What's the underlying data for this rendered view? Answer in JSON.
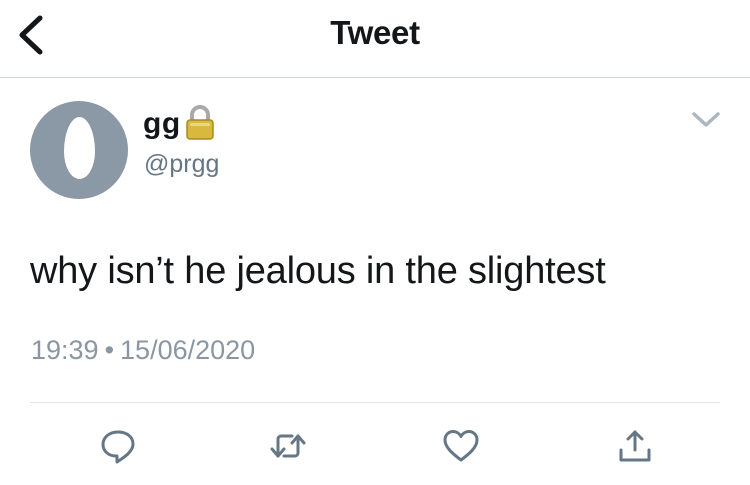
{
  "header": {
    "title": "Tweet",
    "back_icon": "chevron-left-icon"
  },
  "tweet": {
    "author": {
      "display_name": "gg",
      "handle": "@prgg",
      "locked_icon": "lock-icon",
      "avatar": "default-egg-avatar"
    },
    "more_icon": "chevron-down-icon",
    "text": "why isn’t he jealous in the slightest",
    "time": "19:39",
    "separator": "•",
    "date": "15/06/2020"
  },
  "actions": [
    {
      "name": "reply",
      "icon": "reply-icon"
    },
    {
      "name": "retweet",
      "icon": "retweet-icon"
    },
    {
      "name": "like",
      "icon": "heart-icon"
    },
    {
      "name": "share",
      "icon": "share-icon"
    }
  ],
  "colors": {
    "text": "#14171a",
    "secondary_text": "#657786",
    "icon": "#657786",
    "avatar_bg": "#8b98a5",
    "divider": "#cfd5da"
  }
}
